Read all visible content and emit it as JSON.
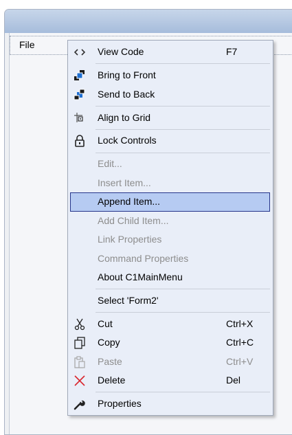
{
  "form": {
    "menu_strip": {
      "file_label": "File"
    }
  },
  "context_menu": {
    "items": [
      {
        "label": "View Code",
        "shortcut": "F7",
        "icon": "code-icon",
        "disabled": false
      },
      {
        "label": "Bring to Front",
        "shortcut": "",
        "icon": "bring-to-front-icon",
        "disabled": false
      },
      {
        "label": "Send to Back",
        "shortcut": "",
        "icon": "send-to-back-icon",
        "disabled": false
      },
      {
        "label": "Align to Grid",
        "shortcut": "",
        "icon": "align-to-grid-icon",
        "disabled": false
      },
      {
        "label": "Lock Controls",
        "shortcut": "",
        "icon": "lock-icon",
        "disabled": false
      },
      {
        "label": "Edit...",
        "shortcut": "",
        "icon": "",
        "disabled": true
      },
      {
        "label": "Insert Item...",
        "shortcut": "",
        "icon": "",
        "disabled": true
      },
      {
        "label": "Append Item...",
        "shortcut": "",
        "icon": "",
        "disabled": false,
        "highlighted": true
      },
      {
        "label": "Add Child Item...",
        "shortcut": "",
        "icon": "",
        "disabled": true
      },
      {
        "label": "Link Properties",
        "shortcut": "",
        "icon": "",
        "disabled": true
      },
      {
        "label": "Command Properties",
        "shortcut": "",
        "icon": "",
        "disabled": true
      },
      {
        "label": "About C1MainMenu",
        "shortcut": "",
        "icon": "",
        "disabled": false
      },
      {
        "label": "Select 'Form2'",
        "shortcut": "",
        "icon": "",
        "disabled": false
      },
      {
        "label": "Cut",
        "shortcut": "Ctrl+X",
        "icon": "scissors-icon",
        "disabled": false
      },
      {
        "label": "Copy",
        "shortcut": "Ctrl+C",
        "icon": "copy-icon",
        "disabled": false
      },
      {
        "label": "Paste",
        "shortcut": "Ctrl+V",
        "icon": "paste-icon",
        "disabled": true
      },
      {
        "label": "Delete",
        "shortcut": "Del",
        "icon": "delete-x-icon",
        "disabled": false
      },
      {
        "label": "Properties",
        "shortcut": "",
        "icon": "wrench-icon",
        "disabled": false
      }
    ]
  },
  "colors": {
    "highlight_fill": "#b6cbf2",
    "highlight_border": "#25348a",
    "menu_background": "#e9eef8",
    "delete_icon": "#d9262e"
  }
}
